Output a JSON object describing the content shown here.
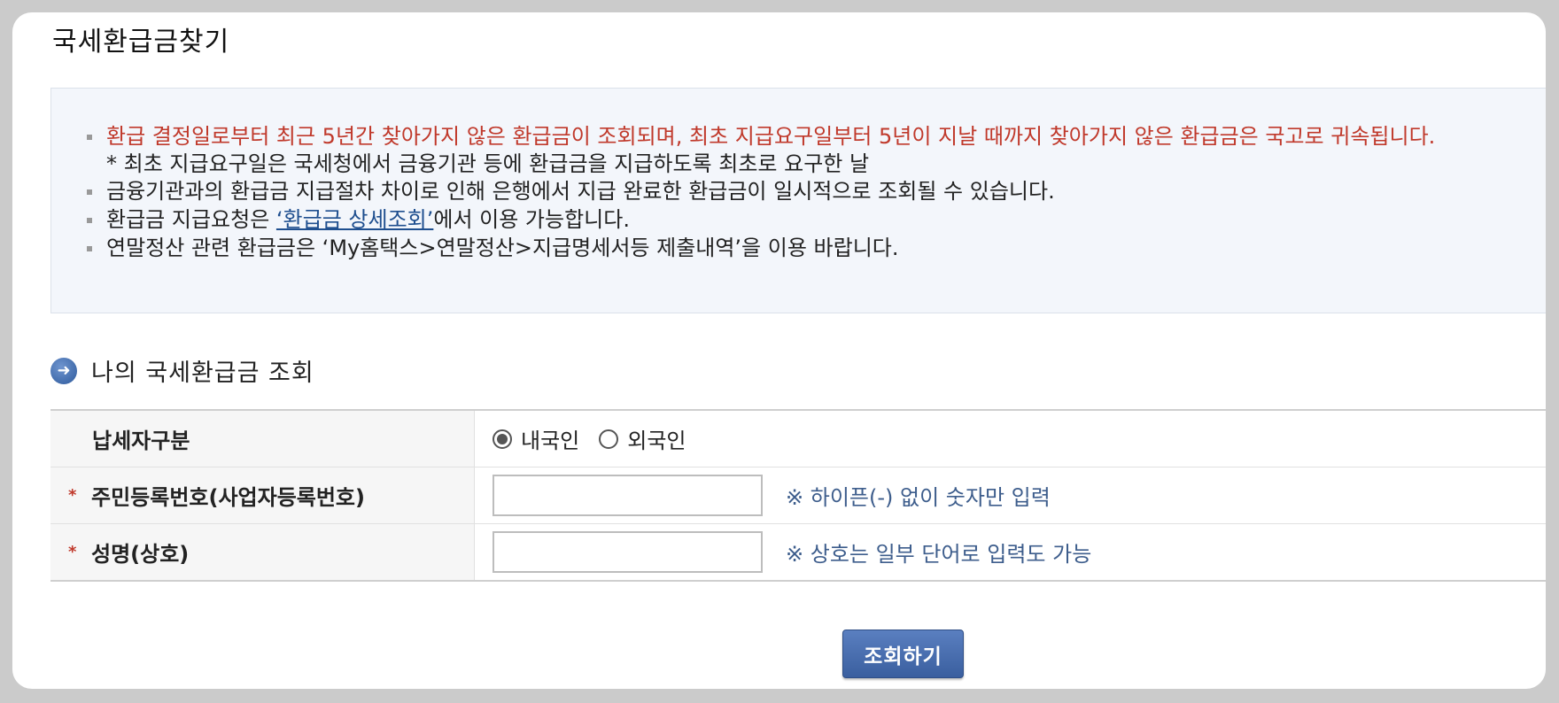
{
  "page": {
    "title": "국세환급금찾기"
  },
  "notice": {
    "items": [
      {
        "text": "환급 결정일로부터 최근 5년간 찾아가지 않은 환급금이 조회되며, 최초 지급요구일부터 5년이 지날 때까지 찾아가지 않은 환급금은 국고로 귀속됩니다."
      },
      {
        "text": "* 최초 지급요구일은 국세청에서 금융기관 등에 환급금을 지급하도록 최초로 요구한 날"
      },
      {
        "text": "금융기관과의 환급금 지급절차 차이로 인해 은행에서 지급 완료한 환급금이 일시적으로 조회될 수 있습니다."
      },
      {
        "text_before": "환급금 지급요청은 ",
        "link": "‘환급금 상세조회’",
        "text_after": "에서 이용 가능합니다."
      },
      {
        "text": "연말정산 관련 환급금은 ‘My홈택스>연말정산>지급명세서등 제출내역’을 이용 바랍니다."
      }
    ]
  },
  "section": {
    "title": "나의 국세환급금 조회",
    "icon": "arrow-right-circle-icon"
  },
  "form": {
    "taxpayer_type": {
      "label": "납세자구분",
      "options": [
        "내국인",
        "외국인"
      ],
      "selected": "내국인"
    },
    "id_number": {
      "label": "주민등록번호(사업자등록번호)",
      "required_mark": "*",
      "value": "",
      "hint": "※ 하이픈(-) 없이 숫자만 입력"
    },
    "name": {
      "label": "성명(상호)",
      "required_mark": "*",
      "value": "",
      "hint": "※ 상호는 일부 단어로 입력도 가능"
    }
  },
  "button": {
    "search_label": "조회하기"
  },
  "colors": {
    "accent": "#3a5f9f",
    "warning": "#c0392b",
    "hint": "#3d5d8c"
  }
}
